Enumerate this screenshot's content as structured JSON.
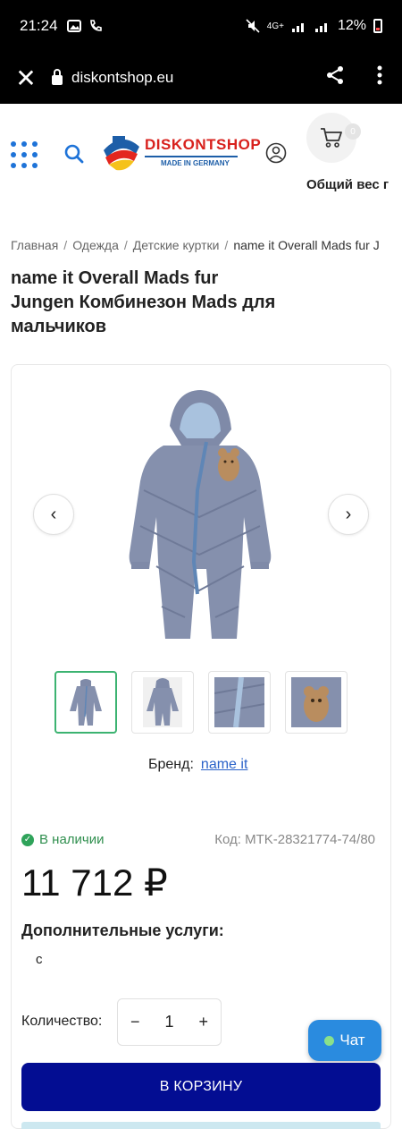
{
  "status_bar": {
    "time": "21:24",
    "network": "4G+",
    "battery": "12%"
  },
  "browser": {
    "url": "diskontshop.eu"
  },
  "header": {
    "logo_text": "DISKONTSHOP",
    "logo_subtext": "MADE IN GERMANY",
    "cart_count": "0",
    "cart_weight_label": "Общий вес г"
  },
  "breadcrumb": {
    "items": [
      "Главная",
      "Одежда",
      "Детские куртки",
      "name it Overall Mads fur J"
    ]
  },
  "product": {
    "title": "name it Overall Mads fur Jungen Комбинезон Mads для мальчиков",
    "brand_label": "Бренд:",
    "brand_value": "name it",
    "stock": "В наличии",
    "sku": "Код: MTK-28321774-74/80",
    "price": "11 712 ₽",
    "services_title": "Дополнительные услуги:",
    "services_value": "с",
    "quantity_label": "Количество:",
    "quantity": "1"
  },
  "buttons": {
    "prev": "‹",
    "next": "›",
    "minus": "−",
    "plus": "+",
    "chat": "Чат",
    "add_to_cart": "В КОРЗИНУ"
  },
  "colors": {
    "brand_blue": "#030d92",
    "accent_blue": "#1e73d8",
    "stock_green": "#2f8f4e",
    "chat_blue": "#2a8bdf",
    "suit_color": "#8590ad"
  }
}
